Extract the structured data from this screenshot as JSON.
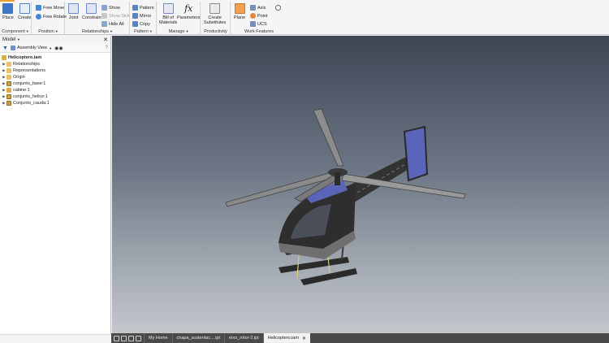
{
  "ribbon": {
    "component": {
      "label": "Component",
      "place": "Place",
      "create": "Create"
    },
    "position": {
      "label": "Position",
      "free_move": "Free Move",
      "free_rotate": "Free Rotate"
    },
    "relationships": {
      "label": "Relationships",
      "joint": "Joint",
      "constrain": "Constrain",
      "show": "Show",
      "show_sick": "Show Sick",
      "hide_all": "Hide All"
    },
    "pattern": {
      "label": "Pattern",
      "pattern": "Pattern",
      "mirror": "Mirror",
      "copy": "Copy"
    },
    "manage": {
      "label": "Manage",
      "bill_line1": "Bill of",
      "bill_line2": "Materials",
      "parameters": "Parameters"
    },
    "productivity": {
      "label": "Productivity",
      "create_line1": "Create",
      "create_line2": "Substitutes"
    },
    "work_features": {
      "label": "Work Features",
      "plane": "Plane",
      "axis": "Axis",
      "point": "Point",
      "ucs": "UCS"
    }
  },
  "browser": {
    "title": "Model",
    "view": "Assembly View",
    "root": "Helicoptero.iam",
    "items": [
      {
        "label": "Relationships",
        "icon": "folder-icon"
      },
      {
        "label": "Representations",
        "icon": "folder-icon"
      },
      {
        "label": "Origin",
        "icon": "folder-icon"
      },
      {
        "label": "conjunto_base:1",
        "icon": "subassembly-icon"
      },
      {
        "label": "cabine:1",
        "icon": "part-icon"
      },
      {
        "label": "conjunto_helice:1",
        "icon": "subassembly-icon"
      },
      {
        "label": "Conjunto_cauda:1",
        "icon": "subassembly-icon"
      }
    ]
  },
  "tabs": [
    {
      "label": "My Home",
      "active": false
    },
    {
      "label": "chapa_sustentac....ipt",
      "active": false
    },
    {
      "label": "eixo_rotor-2.ipt",
      "active": false
    },
    {
      "label": "Helicoptero.iam",
      "active": true
    }
  ],
  "colors": {
    "accent": "#f0a030",
    "viewport_top": "#3e4654",
    "viewport_bottom": "#c3c6cb",
    "model_dark": "#2a2a2a",
    "model_blue": "#5a64b8"
  }
}
